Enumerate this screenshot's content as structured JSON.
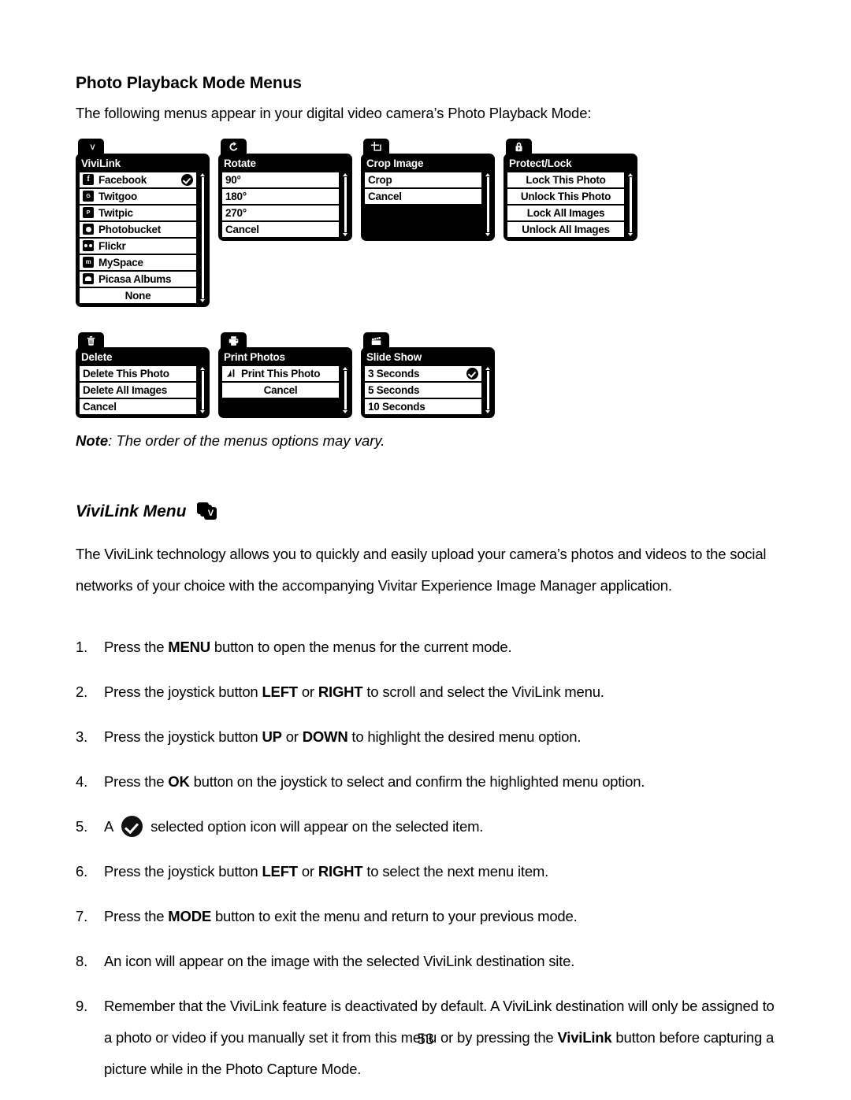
{
  "document": {
    "heading": "Photo Playback Mode Menus",
    "intro": "The following menus appear in your digital video camera’s Photo Playback Mode:",
    "note_label": "Note",
    "note_text": ": The order of the menus options may vary.",
    "section_heading": "ViviLink Menu",
    "page_number": "53"
  },
  "menus": {
    "vivilink": {
      "tab_icon": "vivilink-icon",
      "title": "ViviLink",
      "items": [
        {
          "label": "Facebook",
          "icon": "facebook-icon",
          "selected": true
        },
        {
          "label": "Twitgoo",
          "icon": "twitgoo-icon",
          "selected": false
        },
        {
          "label": "Twitpic",
          "icon": "twitpic-icon",
          "selected": false
        },
        {
          "label": "Photobucket",
          "icon": "photobucket-icon",
          "selected": false
        },
        {
          "label": "Flickr",
          "icon": "flickr-icon",
          "selected": false
        },
        {
          "label": "MySpace",
          "icon": "myspace-icon",
          "selected": false
        },
        {
          "label": "Picasa Albums",
          "icon": "picasa-icon",
          "selected": false
        },
        {
          "label": "None",
          "icon": "",
          "selected": false
        }
      ]
    },
    "rotate": {
      "tab_icon": "rotate-icon",
      "title": "Rotate",
      "items": [
        {
          "label": "90°",
          "icon": "",
          "selected": false
        },
        {
          "label": "180°",
          "icon": "",
          "selected": false
        },
        {
          "label": "270°",
          "icon": "",
          "selected": false
        },
        {
          "label": "Cancel",
          "icon": "",
          "selected": false
        }
      ]
    },
    "crop_image": {
      "tab_icon": "crop-icon",
      "title": "Crop Image",
      "items": [
        {
          "label": "Crop",
          "icon": "",
          "selected": false
        },
        {
          "label": "Cancel",
          "icon": "",
          "selected": false
        }
      ]
    },
    "protect_lock": {
      "tab_icon": "lock-icon",
      "title": "Protect/Lock",
      "items": [
        {
          "label": "Lock This Photo",
          "icon": "",
          "selected": false
        },
        {
          "label": "Unlock This Photo",
          "icon": "",
          "selected": false
        },
        {
          "label": "Lock All Images",
          "icon": "",
          "selected": false
        },
        {
          "label": "Unlock All Images",
          "icon": "",
          "selected": false
        }
      ]
    },
    "delete": {
      "tab_icon": "trash-icon",
      "title": "Delete",
      "items": [
        {
          "label": "Delete This Photo",
          "icon": "",
          "selected": false
        },
        {
          "label": "Delete All Images",
          "icon": "",
          "selected": false
        },
        {
          "label": "Cancel",
          "icon": "",
          "selected": false
        }
      ]
    },
    "print_photos": {
      "tab_icon": "printer-icon",
      "title": "Print Photos",
      "items": [
        {
          "label": "Print This Photo",
          "icon": "pictbridge-icon",
          "selected": false
        },
        {
          "label": "Cancel",
          "icon": "",
          "selected": false
        }
      ]
    },
    "slide_show": {
      "tab_icon": "clapper-icon",
      "title": "Slide Show",
      "items": [
        {
          "label": "3 Seconds",
          "icon": "",
          "selected": true
        },
        {
          "label": "5 Seconds",
          "icon": "",
          "selected": false
        },
        {
          "label": "10 Seconds",
          "icon": "",
          "selected": false
        }
      ]
    }
  },
  "body": {
    "paragraph": "The ViviLink technology allows you to quickly and easily upload your camera’s photos and videos to the social networks of your choice with the accompanying Vivitar Experience Image Manager application.",
    "steps": [
      {
        "num": "1.",
        "parts": [
          {
            "t": "Press the ",
            "b": false
          },
          {
            "t": "MENU",
            "b": true
          },
          {
            "t": " button to open the menus for the current mode.",
            "b": false
          }
        ]
      },
      {
        "num": "2.",
        "parts": [
          {
            "t": "Press the joystick button ",
            "b": false
          },
          {
            "t": "LEFT",
            "b": true
          },
          {
            "t": " or ",
            "b": false
          },
          {
            "t": "RIGHT",
            "b": true
          },
          {
            "t": " to scroll and select the ViviLink menu.",
            "b": false
          }
        ]
      },
      {
        "num": "3.",
        "parts": [
          {
            "t": "Press the joystick button ",
            "b": false
          },
          {
            "t": "UP",
            "b": true
          },
          {
            "t": " or ",
            "b": false
          },
          {
            "t": "DOWN",
            "b": true
          },
          {
            "t": " to highlight the desired menu option.",
            "b": false
          }
        ]
      },
      {
        "num": "4.",
        "parts": [
          {
            "t": "Press the ",
            "b": false
          },
          {
            "t": "OK",
            "b": true
          },
          {
            "t": " button on the joystick to select and confirm the highlighted menu option.",
            "b": false
          }
        ]
      },
      {
        "num": "5.",
        "icon": "selected-option-check-icon",
        "parts": [
          {
            "t": "A ",
            "b": false
          },
          {
            "t": "__ICON__",
            "b": false
          },
          {
            "t": "selected option icon will appear on the selected item.",
            "b": false
          }
        ]
      },
      {
        "num": "6.",
        "parts": [
          {
            "t": "Press the joystick button ",
            "b": false
          },
          {
            "t": "LEFT",
            "b": true
          },
          {
            "t": " or ",
            "b": false
          },
          {
            "t": "RIGHT",
            "b": true
          },
          {
            "t": " to select the next menu item.",
            "b": false
          }
        ]
      },
      {
        "num": "7.",
        "parts": [
          {
            "t": "Press the ",
            "b": false
          },
          {
            "t": "MODE",
            "b": true
          },
          {
            "t": " button to exit the menu and return to your previous mode.",
            "b": false
          }
        ]
      },
      {
        "num": "8.",
        "parts": [
          {
            "t": "An icon will appear on the image with the selected ViviLink destination site.",
            "b": false
          }
        ]
      },
      {
        "num": "9.",
        "parts": [
          {
            "t": "Remember that the ViviLink feature is deactivated by default. A ViviLink destination will only be assigned to a photo or video if you manually set it from this menu or by pressing the ",
            "b": false
          },
          {
            "t": "ViviLink",
            "b": true
          },
          {
            "t": " button before capturing a picture while in the Photo Capture Mode.",
            "b": false
          }
        ]
      }
    ]
  }
}
